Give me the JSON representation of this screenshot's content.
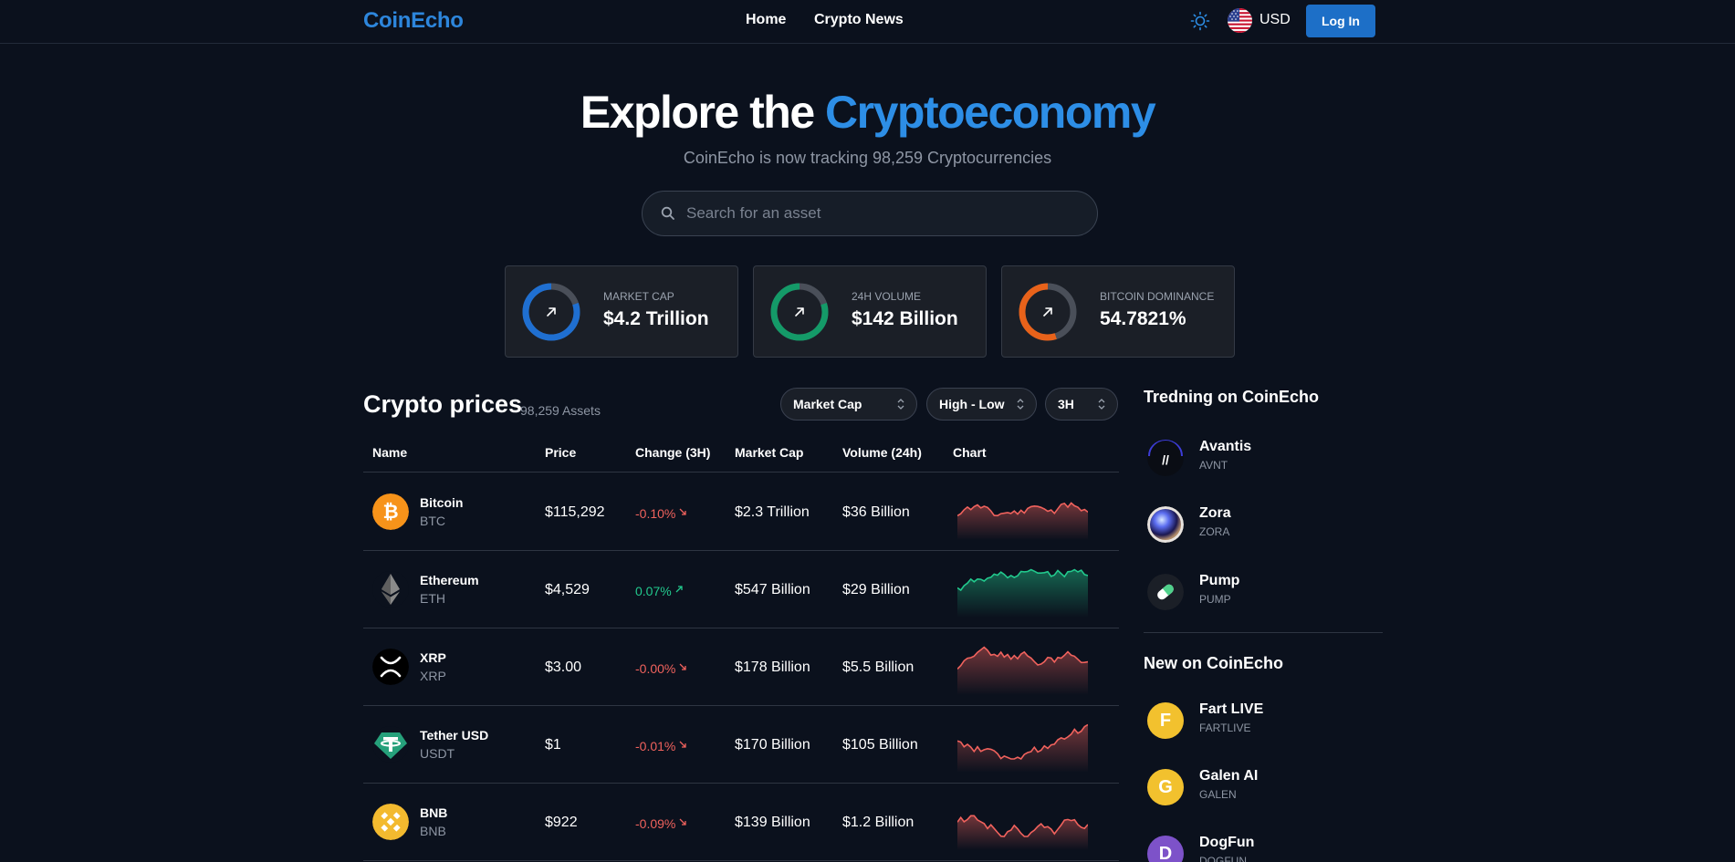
{
  "header": {
    "brand": "CoinEcho",
    "nav": [
      {
        "label": "Home"
      },
      {
        "label": "Crypto News"
      }
    ],
    "currency": "USD",
    "login_label": "Log In",
    "theme_icon": "sun-icon",
    "flag_icon": "us-flag-icon"
  },
  "hero": {
    "title_prefix": "Explore the ",
    "title_accent": "Cryptoeconomy",
    "subtitle": "CoinEcho is now tracking 98,259 Cryptocurrencies",
    "search_placeholder": "Search for an asset"
  },
  "stats": [
    {
      "label": "MARKET CAP",
      "value": "$4.2 Trillion",
      "color": "#1f6fd1",
      "fill": 0.8
    },
    {
      "label": "24H VOLUME",
      "value": "$142 Billion",
      "color": "#149a68",
      "fill": 0.8
    },
    {
      "label": "BITCOIN DOMINANCE",
      "value": "54.7821%",
      "color": "#e8621a",
      "fill": 0.55
    }
  ],
  "prices": {
    "title": "Crypto prices",
    "count": "98,259 Assets",
    "filters": {
      "sort_by": "Market Cap",
      "order": "High - Low",
      "period": "3H"
    },
    "columns": [
      "Name",
      "Price",
      "Change (3H)",
      "Market Cap",
      "Volume (24h)",
      "Chart"
    ],
    "rows": [
      {
        "name": "Bitcoin",
        "symbol": "BTC",
        "price": "$115,292",
        "change": "-0.10%",
        "direction": "down",
        "market_cap": "$2.3 Trillion",
        "volume": "$36 Billion",
        "icon": "bitcoin-icon"
      },
      {
        "name": "Ethereum",
        "symbol": "ETH",
        "price": "$4,529",
        "change": "0.07%",
        "direction": "up",
        "market_cap": "$547 Billion",
        "volume": "$29 Billion",
        "icon": "ethereum-icon"
      },
      {
        "name": "XRP",
        "symbol": "XRP",
        "price": "$3.00",
        "change": "-0.00%",
        "direction": "down",
        "market_cap": "$178 Billion",
        "volume": "$5.5 Billion",
        "icon": "xrp-icon"
      },
      {
        "name": "Tether USD",
        "symbol": "USDT",
        "price": "$1",
        "change": "-0.01%",
        "direction": "down",
        "market_cap": "$170 Billion",
        "volume": "$105 Billion",
        "icon": "tether-icon"
      },
      {
        "name": "BNB",
        "symbol": "BNB",
        "price": "$922",
        "change": "-0.09%",
        "direction": "down",
        "market_cap": "$139 Billion",
        "volume": "$1.2 Billion",
        "icon": "bnb-icon"
      }
    ]
  },
  "trending": {
    "title": "Tredning on CoinEcho",
    "items": [
      {
        "name": "Avantis",
        "symbol": "AVNT",
        "icon": "avantis-icon"
      },
      {
        "name": "Zora",
        "symbol": "ZORA",
        "icon": "zora-icon"
      },
      {
        "name": "Pump",
        "symbol": "PUMP",
        "icon": "pump-pill-icon"
      }
    ]
  },
  "new_listings": {
    "title": "New on CoinEcho",
    "items": [
      {
        "name": "Fart LIVE",
        "symbol": "FARTLIVE",
        "letter": "F",
        "color": "#f2c12e"
      },
      {
        "name": "Galen AI",
        "symbol": "GALEN",
        "letter": "G",
        "color": "#f2c12e"
      },
      {
        "name": "DogFun",
        "symbol": "DOGFUN",
        "letter": "D",
        "color": "#7d52c9"
      }
    ]
  },
  "colors": {
    "accent": "#2d8ee6",
    "down": "#f0625d",
    "up": "#22c98d",
    "background": "#0b111d"
  }
}
